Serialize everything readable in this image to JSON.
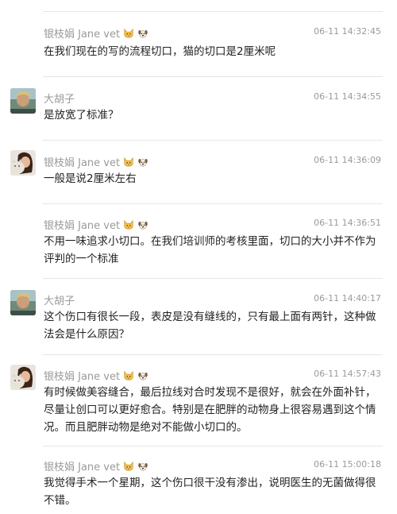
{
  "messages": [
    {
      "author": "银枝娟 Jane vet",
      "badges": [
        "cat-emoji",
        "dog-emoji"
      ],
      "time": "06-11 14:32:45",
      "text": "在我们现在的写的流程切口，猫的切口是2厘米呢",
      "avatar": "none"
    },
    {
      "author": "大胡子",
      "badges": [],
      "time": "06-11 14:34:55",
      "text": "是放宽了标准？",
      "avatar": "beard-man"
    },
    {
      "author": "银枝娟 Jane vet",
      "badges": [
        "cat-emoji",
        "dog-emoji"
      ],
      "time": "06-11 14:36:09",
      "text": "一般是说2厘米左右",
      "avatar": "woman-with-cat"
    },
    {
      "author": "银枝娟 Jane vet",
      "badges": [
        "cat-emoji",
        "dog-emoji"
      ],
      "time": "06-11 14:36:51",
      "text": "不用一味追求小切口。在我们培训师的考核里面，切口的大小并不作为评判的一个标准",
      "avatar": "none"
    },
    {
      "author": "大胡子",
      "badges": [],
      "time": "06-11 14:40:17",
      "text": "这个伤口有很长一段，表皮是没有缝线的，只有最上面有两针，这种做法会是什么原因？",
      "avatar": "beard-man"
    },
    {
      "author": "银枝娟 Jane vet",
      "badges": [
        "cat-emoji",
        "dog-emoji"
      ],
      "time": "06-11 14:57:43",
      "text": "有时候做美容缝合，最后拉线对合时发现不是很好，就会在外面补针，尽量让创口可以更好愈合。特别是在肥胖的动物身上很容易遇到这个情况。而且肥胖动物是绝对不能做小切口的。",
      "avatar": "woman-with-cat"
    },
    {
      "author": "银枝娟 Jane vet",
      "badges": [
        "cat-emoji",
        "dog-emoji"
      ],
      "time": "06-11 15:00:18",
      "text": "我觉得手术一个星期，这个伤口很干没有渗出，说明医生的无菌做得很不错。",
      "avatar": "none"
    }
  ]
}
